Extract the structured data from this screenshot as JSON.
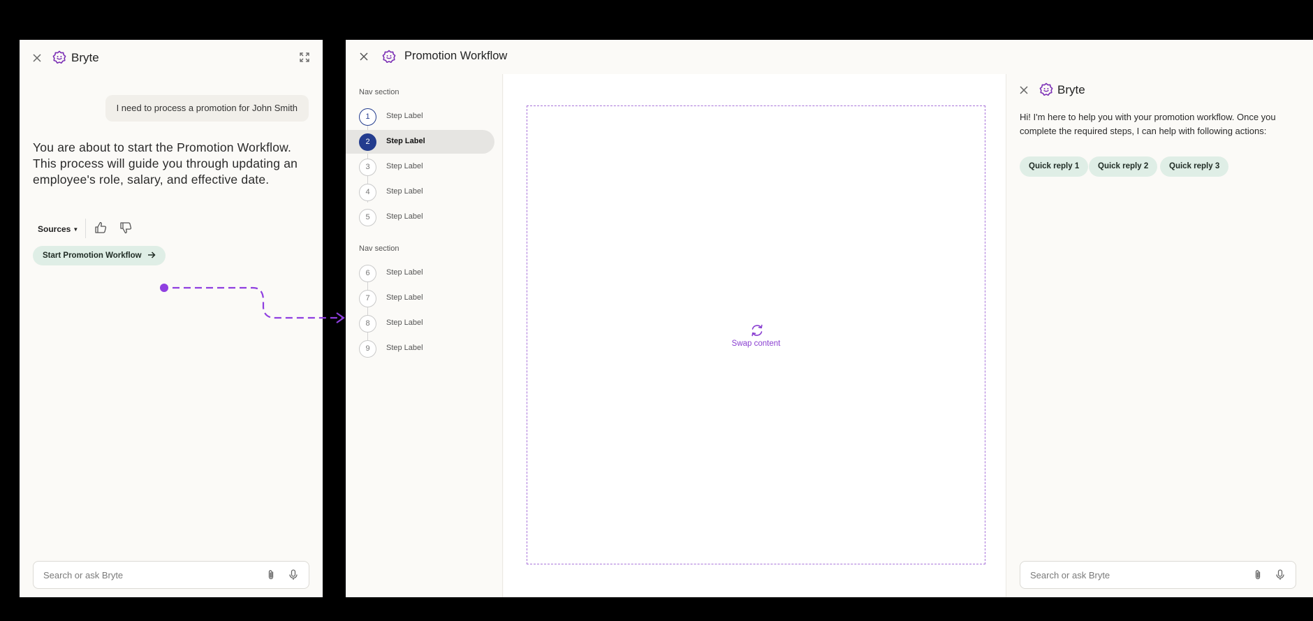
{
  "chat": {
    "brand": "Bryte",
    "user_message": "I need to process a promotion for John Smith",
    "assistant_message": "You are about to start the Promotion Workflow. This process will guide you through updating an employee's role, salary, and effective date.",
    "sources_label": "Sources",
    "start_button": "Start Promotion Workflow",
    "search_placeholder": "Search or ask Bryte"
  },
  "workflow": {
    "title": "Promotion Workflow",
    "nav": [
      {
        "section": "Nav section",
        "steps": [
          {
            "num": "1",
            "label": "Step Label",
            "state": "done"
          },
          {
            "num": "2",
            "label": "Step Label",
            "state": "active"
          },
          {
            "num": "3",
            "label": "Step Label",
            "state": "todo"
          },
          {
            "num": "4",
            "label": "Step Label",
            "state": "todo"
          },
          {
            "num": "5",
            "label": "Step Label",
            "state": "todo"
          }
        ]
      },
      {
        "section": "Nav section",
        "steps": [
          {
            "num": "6",
            "label": "Step Label",
            "state": "todo"
          },
          {
            "num": "7",
            "label": "Step Label",
            "state": "todo"
          },
          {
            "num": "8",
            "label": "Step Label",
            "state": "todo"
          },
          {
            "num": "9",
            "label": "Step Label",
            "state": "todo"
          }
        ]
      }
    ],
    "swap_label": "Swap content"
  },
  "assistant": {
    "brand": "Bryte",
    "message": "Hi! I'm here to help you with your promotion workflow. Once you complete the required steps, I can help with following actions:",
    "quick_replies": [
      "Quick reply 1",
      "Quick reply 2",
      "Quick reply 3"
    ],
    "search_placeholder": "Search or ask Bryte"
  },
  "colors": {
    "brand_purple": "#7b2fb5",
    "step_blue": "#233c8e",
    "chip_green": "#dfeee6",
    "connector_purple": "#8f3fe0"
  },
  "icons": [
    "close-icon",
    "bryte-logo-icon",
    "expand-icon",
    "thumbs-up-icon",
    "thumbs-down-icon",
    "arrow-right-icon",
    "paperclip-icon",
    "microphone-icon",
    "refresh-icon"
  ]
}
